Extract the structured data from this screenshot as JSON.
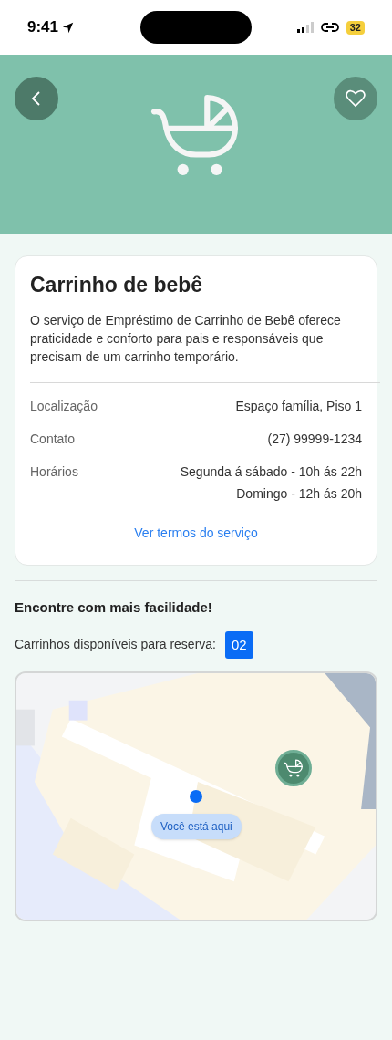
{
  "status_bar": {
    "time": "9:41",
    "battery": "32"
  },
  "card": {
    "title": "Carrinho de bebê",
    "description": "O serviço de Empréstimo de Carrinho de Bebê oferece praticidade e conforto para pais e responsáveis que precisam de um carrinho temporário.",
    "details": [
      {
        "label": "Localização",
        "values": [
          "Espaço família, Piso 1"
        ]
      },
      {
        "label": "Contato",
        "values": [
          "(27) 99999-1234"
        ]
      },
      {
        "label": "Horários",
        "values": [
          "Segunda á sábado - 10h ás 22h",
          "Domingo - 12h ás 20h"
        ]
      }
    ],
    "link": "Ver termos do serviço"
  },
  "availability": {
    "heading": "Encontre com mais facilidade!",
    "label": "Carrinhos disponíveis para reserva:",
    "count": "02"
  },
  "map": {
    "kind": "picture",
    "you_are_here": "Você está aqui"
  }
}
